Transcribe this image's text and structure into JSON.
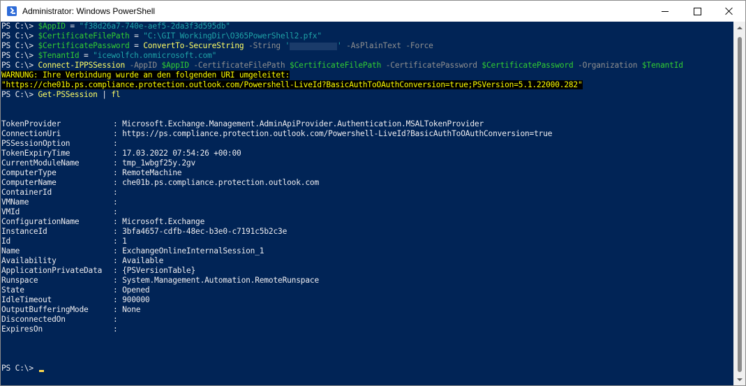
{
  "window": {
    "title": "Administrator: Windows PowerShell",
    "icon": "powershell-icon",
    "buttons": [
      "minimize-icon",
      "maximize-icon",
      "close-icon"
    ]
  },
  "colors": {
    "background": "#012456",
    "text": "#eeedf0",
    "variable": "#32cd32",
    "string": "#1fa3a8",
    "parameter": "#8f8f8f",
    "command": "#ffff66",
    "warning_bg": "#000000",
    "warning_fg": "#ffff00"
  },
  "prompt": "PS C:\\> ",
  "commands": {
    "c1": {
      "var": "$AppID",
      "op": " = ",
      "value": "\"f38d26a7-740e-aef5-2da3f3d595db\""
    },
    "c2": {
      "var": "$CertificateFilePath",
      "op": " = ",
      "value": "\"C:\\GIT_WorkingDir\\O365PowerShell2.pfx\""
    },
    "c3": {
      "var": "$CertificatePassword",
      "op": " = ",
      "cmd": "ConvertTo-SecureString",
      "p1": " -String ",
      "q1": "'",
      "q2": "'",
      "p2": " -AsPlainText -Force"
    },
    "c4": {
      "var": "$TenantId",
      "op": " = ",
      "value": "\"icewolfch.onmicrosoft.com\""
    },
    "c5": {
      "cmd": "Connect-IPPSSession",
      "p1": " -AppID ",
      "v1": "$AppID",
      "p2": " -CertificateFilePath ",
      "v2": "$CertificateFilePath",
      "p3": " -CertificatePassword ",
      "v3": "$CertificatePassword",
      "p4": " -Organization ",
      "v4": "$TenantId"
    },
    "c6": {
      "cmd": "Get-PSSession",
      "pipe": " | ",
      "cmd2": "fl"
    }
  },
  "warning": {
    "line1": "WARNUNG: Ihre Verbindung wurde an den folgenden URI umgeleitet:",
    "line2": "\"https://che01b.ps.compliance.protection.outlook.com/Powershell-LiveId?BasicAuthToOAuthConversion=true;PSVersion=5.1.22000.282\""
  },
  "properties": [
    {
      "name": "TokenProvider",
      "value": "Microsoft.Exchange.Management.AdminApiProvider.Authentication.MSALTokenProvider"
    },
    {
      "name": "ConnectionUri",
      "value": "https://ps.compliance.protection.outlook.com/Powershell-LiveId?BasicAuthToOAuthConversion=true"
    },
    {
      "name": "PSSessionOption",
      "value": ""
    },
    {
      "name": "TokenExpiryTime",
      "value": "17.03.2022 07:54:26 +00:00"
    },
    {
      "name": "CurrentModuleName",
      "value": "tmp_1wbgf25y.2gv"
    },
    {
      "name": "ComputerType",
      "value": "RemoteMachine"
    },
    {
      "name": "ComputerName",
      "value": "che01b.ps.compliance.protection.outlook.com"
    },
    {
      "name": "ContainerId",
      "value": ""
    },
    {
      "name": "VMName",
      "value": ""
    },
    {
      "name": "VMId",
      "value": ""
    },
    {
      "name": "ConfigurationName",
      "value": "Microsoft.Exchange"
    },
    {
      "name": "InstanceId",
      "value": "3bfa4657-cdfb-48ec-b3e0-c7191c5b2c3e"
    },
    {
      "name": "Id",
      "value": "1"
    },
    {
      "name": "Name",
      "value": "ExchangeOnlineInternalSession_1"
    },
    {
      "name": "Availability",
      "value": "Available"
    },
    {
      "name": "ApplicationPrivateData",
      "value": "{PSVersionTable}"
    },
    {
      "name": "Runspace",
      "value": "System.Management.Automation.RemoteRunspace"
    },
    {
      "name": "State",
      "value": "Opened"
    },
    {
      "name": "IdleTimeout",
      "value": "900000"
    },
    {
      "name": "OutputBufferingMode",
      "value": "None"
    },
    {
      "name": "DisconnectedOn",
      "value": ""
    },
    {
      "name": "ExpiresOn",
      "value": ""
    }
  ],
  "separator": ": "
}
